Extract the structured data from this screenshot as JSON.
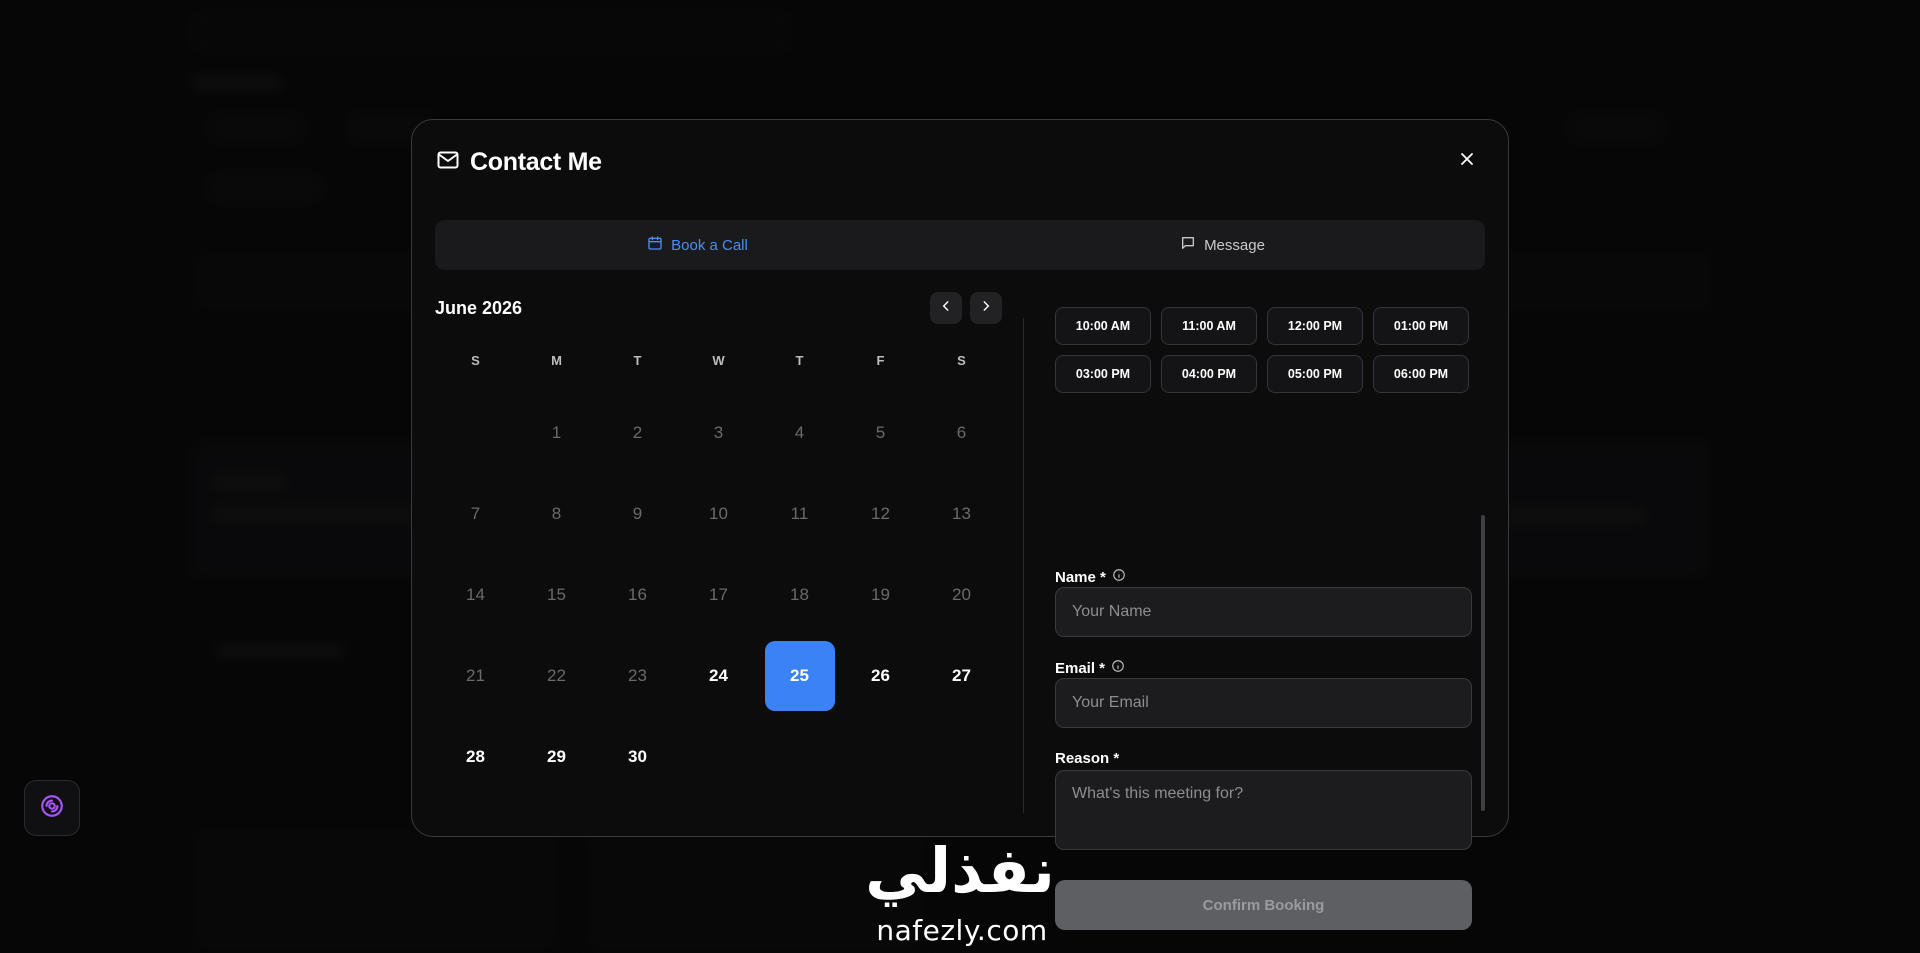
{
  "modal": {
    "title": "Contact Me",
    "tabs": [
      {
        "label": "Book a Call",
        "active": true
      },
      {
        "label": "Message",
        "active": false
      }
    ]
  },
  "calendar": {
    "month_label": "June 2026",
    "weekdays": [
      "S",
      "M",
      "T",
      "W",
      "T",
      "F",
      "S"
    ],
    "first_weekday_index": 1,
    "days": [
      {
        "n": "1",
        "state": "past"
      },
      {
        "n": "2",
        "state": "past"
      },
      {
        "n": "3",
        "state": "past"
      },
      {
        "n": "4",
        "state": "past"
      },
      {
        "n": "5",
        "state": "past"
      },
      {
        "n": "6",
        "state": "past"
      },
      {
        "n": "7",
        "state": "past"
      },
      {
        "n": "8",
        "state": "past"
      },
      {
        "n": "9",
        "state": "past"
      },
      {
        "n": "10",
        "state": "past"
      },
      {
        "n": "11",
        "state": "past"
      },
      {
        "n": "12",
        "state": "past"
      },
      {
        "n": "13",
        "state": "past"
      },
      {
        "n": "14",
        "state": "past"
      },
      {
        "n": "15",
        "state": "past"
      },
      {
        "n": "16",
        "state": "past"
      },
      {
        "n": "17",
        "state": "past"
      },
      {
        "n": "18",
        "state": "past"
      },
      {
        "n": "19",
        "state": "past"
      },
      {
        "n": "20",
        "state": "past"
      },
      {
        "n": "21",
        "state": "past"
      },
      {
        "n": "22",
        "state": "past"
      },
      {
        "n": "23",
        "state": "past"
      },
      {
        "n": "24",
        "state": "available"
      },
      {
        "n": "25",
        "state": "selected"
      },
      {
        "n": "26",
        "state": "available"
      },
      {
        "n": "27",
        "state": "available"
      },
      {
        "n": "28",
        "state": "available"
      },
      {
        "n": "29",
        "state": "available"
      },
      {
        "n": "30",
        "state": "available"
      }
    ]
  },
  "time_slots": [
    "10:00 AM",
    "11:00 AM",
    "12:00 PM",
    "01:00 PM",
    "03:00 PM",
    "04:00 PM",
    "05:00 PM",
    "06:00 PM"
  ],
  "form": {
    "name_label": "Name *",
    "name_placeholder": "Your Name",
    "email_label": "Email *",
    "email_placeholder": "Your Email",
    "reason_label": "Reason *",
    "reason_placeholder": "What's this meeting for?",
    "submit_label": "Confirm Booking"
  },
  "watermark": {
    "arabic": "نفذلي",
    "latin": "nafezly.com"
  },
  "colors": {
    "accent": "#3b82f6",
    "tab_active": "#4a8ff0",
    "fab_icon": "#a855f7",
    "submit_disabled_bg": "#5e5f63"
  },
  "icons": {
    "header": "mail-icon",
    "close": "close-icon",
    "tab_book": "calendar-icon",
    "tab_message": "message-square-icon",
    "prev": "chevron-left-icon",
    "next": "chevron-right-icon",
    "info": "info-icon",
    "fab": "disc-icon"
  }
}
